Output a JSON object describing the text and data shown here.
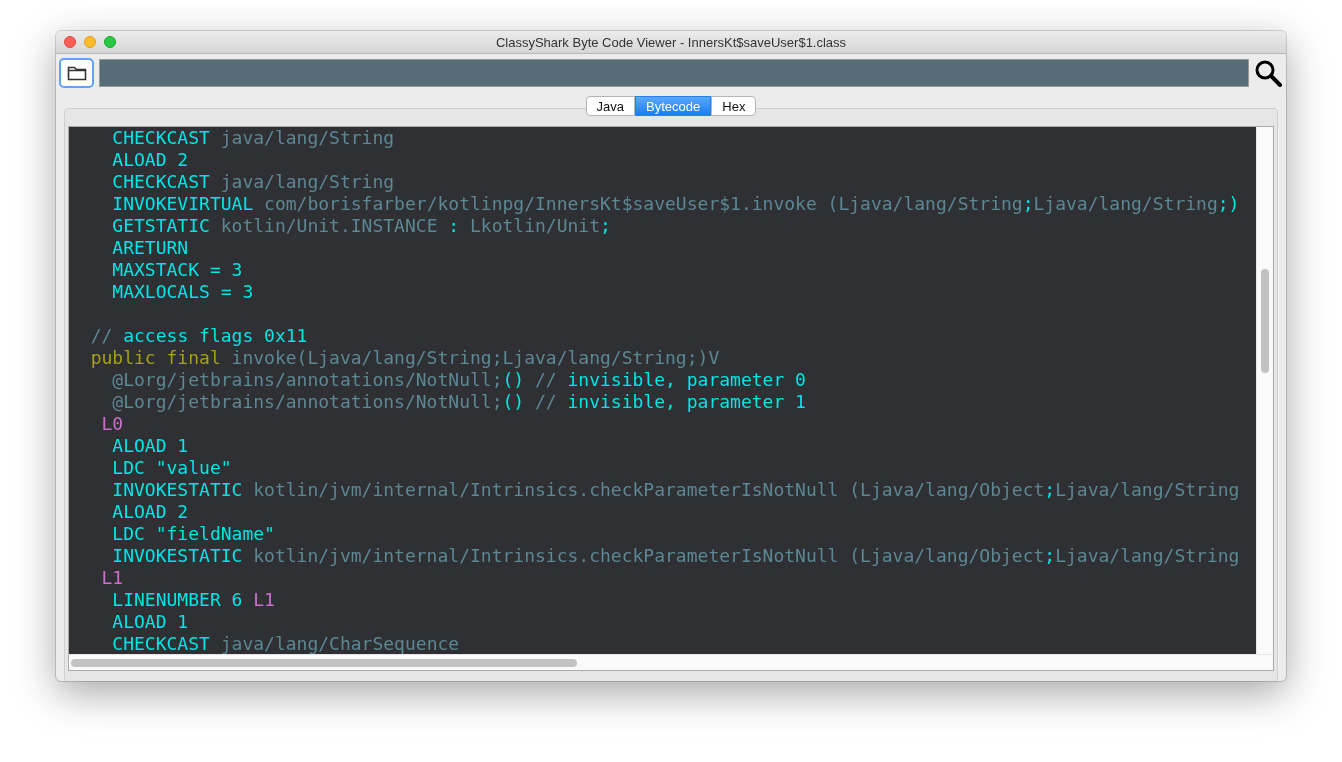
{
  "window": {
    "title": "ClassyShark Byte Code Viewer - InnersKt$saveUser$1.class"
  },
  "tabs": [
    {
      "label": "Java",
      "selected": false
    },
    {
      "label": "Bytecode",
      "selected": true
    },
    {
      "label": "Hex",
      "selected": false
    }
  ],
  "code_lines": [
    {
      "kind": "instruction",
      "segments": [
        {
          "kind": "opcode",
          "text": "CHECKCAST"
        },
        {
          "kind": "reference",
          "text": " java/lang/String"
        }
      ]
    },
    {
      "kind": "instruction",
      "segments": [
        {
          "kind": "opcode",
          "text": "ALOAD 2"
        }
      ]
    },
    {
      "kind": "instruction",
      "segments": [
        {
          "kind": "opcode",
          "text": "CHECKCAST"
        },
        {
          "kind": "reference",
          "text": " java/lang/String"
        }
      ]
    },
    {
      "kind": "instruction",
      "segments": [
        {
          "kind": "opcode",
          "text": "INVOKEVIRTUAL"
        },
        {
          "kind": "reference",
          "text": " com/borisfarber/kotlinpg/InnersKt$saveUser$1.invoke (Ljava/lang/String"
        },
        {
          "kind": "opcode",
          "text": ";"
        },
        {
          "kind": "reference",
          "text": "Ljava/lang/String"
        },
        {
          "kind": "opcode",
          "text": ";)"
        }
      ]
    },
    {
      "kind": "instruction",
      "segments": [
        {
          "kind": "opcode",
          "text": "GETSTATIC"
        },
        {
          "kind": "reference",
          "text": " kotlin/Unit.INSTANCE"
        },
        {
          "kind": "opcode",
          "text": " : "
        },
        {
          "kind": "reference",
          "text": "Lkotlin/Unit"
        },
        {
          "kind": "opcode",
          "text": ";"
        }
      ]
    },
    {
      "kind": "instruction",
      "segments": [
        {
          "kind": "opcode",
          "text": "ARETURN"
        }
      ]
    },
    {
      "kind": "instruction",
      "segments": [
        {
          "kind": "opcode",
          "text": "MAXSTACK = 3"
        }
      ]
    },
    {
      "kind": "instruction",
      "segments": [
        {
          "kind": "opcode",
          "text": "MAXLOCALS = 3"
        }
      ]
    },
    {
      "kind": "blank"
    },
    {
      "kind": "member",
      "segments": [
        {
          "kind": "comment",
          "text": "//"
        },
        {
          "kind": "opcode",
          "text": " access flags 0x11"
        }
      ]
    },
    {
      "kind": "member",
      "segments": [
        {
          "kind": "keyword",
          "text": "public final"
        },
        {
          "kind": "reference",
          "text": " invoke(Ljava/lang/String;Ljava/lang/String;)V"
        }
      ]
    },
    {
      "kind": "instruction",
      "segments": [
        {
          "kind": "reference",
          "text": "@Lorg/jetbrains/annotations/NotNull;"
        },
        {
          "kind": "opcode",
          "text": "()"
        },
        {
          "kind": "comment",
          "text": " //"
        },
        {
          "kind": "opcode",
          "text": " invisible, parameter 0"
        }
      ]
    },
    {
      "kind": "instruction",
      "segments": [
        {
          "kind": "reference",
          "text": "@Lorg/jetbrains/annotations/NotNull;"
        },
        {
          "kind": "opcode",
          "text": "()"
        },
        {
          "kind": "comment",
          "text": " //"
        },
        {
          "kind": "opcode",
          "text": " invisible, parameter 1"
        }
      ]
    },
    {
      "kind": "label",
      "segments": [
        {
          "kind": "label",
          "text": "L0"
        }
      ]
    },
    {
      "kind": "instruction",
      "segments": [
        {
          "kind": "opcode",
          "text": "ALOAD 1"
        }
      ]
    },
    {
      "kind": "instruction",
      "segments": [
        {
          "kind": "opcode",
          "text": "LDC \"value\""
        }
      ]
    },
    {
      "kind": "instruction",
      "segments": [
        {
          "kind": "opcode",
          "text": "INVOKESTATIC"
        },
        {
          "kind": "reference",
          "text": " kotlin/jvm/internal/Intrinsics.checkParameterIsNotNull (Ljava/lang/Object"
        },
        {
          "kind": "opcode",
          "text": ";"
        },
        {
          "kind": "reference",
          "text": "Ljava/lang/String"
        }
      ]
    },
    {
      "kind": "instruction",
      "segments": [
        {
          "kind": "opcode",
          "text": "ALOAD 2"
        }
      ]
    },
    {
      "kind": "instruction",
      "segments": [
        {
          "kind": "opcode",
          "text": "LDC \"fieldName\""
        }
      ]
    },
    {
      "kind": "instruction",
      "segments": [
        {
          "kind": "opcode",
          "text": "INVOKESTATIC"
        },
        {
          "kind": "reference",
          "text": " kotlin/jvm/internal/Intrinsics.checkParameterIsNotNull (Ljava/lang/Object"
        },
        {
          "kind": "opcode",
          "text": ";"
        },
        {
          "kind": "reference",
          "text": "Ljava/lang/String"
        }
      ]
    },
    {
      "kind": "label",
      "segments": [
        {
          "kind": "label",
          "text": "L1"
        }
      ]
    },
    {
      "kind": "instruction",
      "segments": [
        {
          "kind": "opcode",
          "text": "LINENUMBER 6"
        },
        {
          "kind": "label",
          "text": " L1"
        }
      ]
    },
    {
      "kind": "instruction",
      "segments": [
        {
          "kind": "opcode",
          "text": "ALOAD 1"
        }
      ]
    },
    {
      "kind": "instruction",
      "segments": [
        {
          "kind": "opcode",
          "text": "CHECKCAST"
        },
        {
          "kind": "reference",
          "text": " java/lang/CharSequence"
        }
      ]
    }
  ]
}
